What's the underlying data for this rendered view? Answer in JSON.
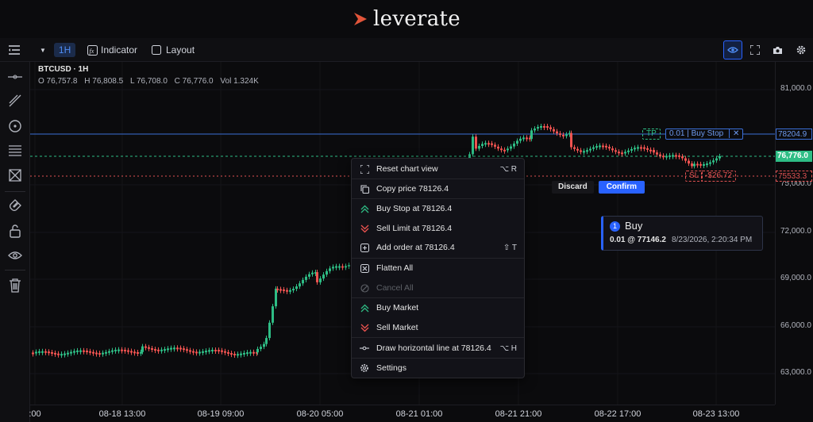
{
  "brand": {
    "name": "leverate"
  },
  "toolbar": {
    "timeframe": "1H",
    "indicator_label": "Indicator",
    "layout_label": "Layout"
  },
  "legend": {
    "symbol": "BTCUSD · 1H",
    "open": "O 76,757.8",
    "high": "H 76,808.5",
    "low": "L 76,708.0",
    "close": "C 76,776.0",
    "volume": "Vol 1.324K"
  },
  "price_axis": {
    "ticks": [
      "81,000.0",
      "75,000.0",
      "72,000.0",
      "69,000.0",
      "66,000.0",
      "63,000.0"
    ]
  },
  "time_axis": {
    "ticks": [
      ":00",
      "08-18 13:00",
      "08-19 09:00",
      "08-20 05:00",
      "08-21 01:00",
      "08-21 21:00",
      "08-22 17:00",
      "08-23 13:00"
    ]
  },
  "price_labels": {
    "buy_stop": "78204.9",
    "current": "76,776.0",
    "stop_loss": "75533.3"
  },
  "order": {
    "tp_label": "TP",
    "qty_label": "0.01 | Buy Stop",
    "close_label": "✕",
    "sl_label": "SL",
    "sl_pnl": "-$26.72"
  },
  "confirm": {
    "discard_label": "Discard",
    "confirm_label": "Confirm"
  },
  "buy_card": {
    "badge": "1",
    "title": "Buy",
    "detail": "0.01 @ 77146.2",
    "time": "8/23/2026, 2:20:34 PM"
  },
  "context_menu": {
    "items": [
      {
        "icon": "fullscreen-icon",
        "label": "Reset chart view",
        "shortcut": "⌥ R"
      },
      {
        "icon": "copy-icon",
        "label": "Copy price 78126.4",
        "shortcut": ""
      },
      {
        "icon": "double-chevron-up-icon",
        "label": "Buy Stop at 78126.4",
        "shortcut": ""
      },
      {
        "icon": "double-chevron-down-icon",
        "label": "Sell Limit at 78126.4",
        "shortcut": ""
      },
      {
        "icon": "plus-square-icon",
        "label": "Add order at 78126.4",
        "shortcut": "⇧ T"
      },
      {
        "icon": "close-square-icon",
        "label": "Flatten All",
        "shortcut": ""
      },
      {
        "icon": "ban-icon",
        "label": "Cancel All",
        "shortcut": ""
      },
      {
        "icon": "double-chevron-up-icon",
        "label": "Buy Market",
        "shortcut": ""
      },
      {
        "icon": "double-chevron-down-icon",
        "label": "Sell Market",
        "shortcut": ""
      },
      {
        "icon": "horizontal-line-icon",
        "label": "Draw horizontal line at 78126.4",
        "shortcut": "⌥ H"
      },
      {
        "icon": "gear-icon",
        "label": "Settings",
        "shortcut": ""
      }
    ]
  },
  "colors": {
    "up": "#26a69a",
    "up_bright": "#2ebd85",
    "down": "#ef5350",
    "accent": "#2962ff",
    "buy_stop_line": "#3b6fd8",
    "current_line": "#2ebd85",
    "sl_line": "#e05252"
  }
}
